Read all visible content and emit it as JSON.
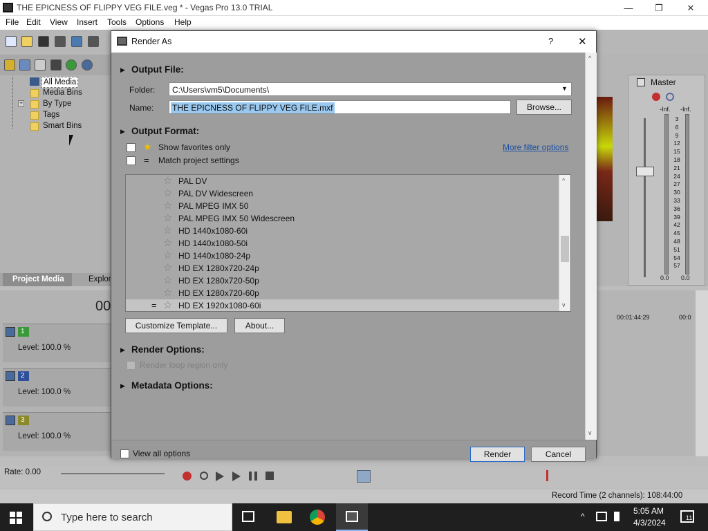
{
  "window": {
    "title": "THE EPICNESS OF FLIPPY VEG FILE.veg * - Vegas Pro 13.0 TRIAL",
    "minimize": "—",
    "maximize": "❐",
    "close": "✕"
  },
  "menu": [
    "File",
    "Edit",
    "View",
    "Insert",
    "Tools",
    "Options",
    "Help"
  ],
  "project_tree": {
    "items": [
      "All Media",
      "Media Bins",
      "By Type",
      "Tags",
      "Smart Bins"
    ],
    "expand": "+"
  },
  "panel_tabs": {
    "project_media": "Project Media",
    "explorer": "Explor"
  },
  "timeline": {
    "time_partial": "00",
    "tracks": [
      {
        "number": "1",
        "level": "Level: 100.0 %",
        "color": "#3a9a3a"
      },
      {
        "number": "2",
        "level": "Level: 100.0 %",
        "color": "#2f4f9a"
      },
      {
        "number": "3",
        "level": "Level: 100.0 %",
        "color": "#8a8a2a"
      }
    ],
    "rate": "Rate: 0.00",
    "ruler_time": "00:01:44:29",
    "ruler_time_partial": "00:0"
  },
  "mixer": {
    "title": "Master",
    "left_inf": "-Inf.",
    "right_inf": "-Inf.",
    "scale": [
      "3",
      "6",
      "9",
      "12",
      "15",
      "18",
      "21",
      "24",
      "27",
      "30",
      "33",
      "36",
      "39",
      "42",
      "45",
      "48",
      "51",
      "54",
      "57"
    ],
    "left_value": "0.0",
    "right_value": "0.0"
  },
  "status": {
    "record_time": "Record Time (2 channels): 108:44:00"
  },
  "dialog": {
    "title": "Render As",
    "help": "?",
    "close": "✕",
    "output_file": {
      "header": "Output File:",
      "folder_label": "Folder:",
      "folder_value": "C:\\Users\\vm5\\Documents\\",
      "name_label": "Name:",
      "name_value": "THE EPICNESS OF FLIPPY VEG FILE.mxf",
      "browse": "Browse..."
    },
    "output_format": {
      "header": "Output Format:",
      "show_favorites": "Show favorites only",
      "match_project": "Match project settings",
      "more_filter": "More filter options",
      "templates": [
        "PAL DV",
        "PAL DV Widescreen",
        "PAL MPEG IMX 50",
        "PAL MPEG IMX 50 Widescreen",
        "HD 1440x1080-60i",
        "HD 1440x1080-50i",
        "HD 1440x1080-24p",
        "HD EX 1280x720-24p",
        "HD EX 1280x720-50p",
        "HD EX 1280x720-60p",
        "HD EX 1920x1080-60i"
      ],
      "selected_marker": "=",
      "customize": "Customize Template...",
      "about": "About..."
    },
    "render_options": {
      "header": "Render Options:",
      "loop_region": "Render loop region only"
    },
    "metadata_options": {
      "header": "Metadata Options:"
    },
    "view_all": "View all options",
    "render": "Render",
    "cancel": "Cancel"
  },
  "taskbar": {
    "search_placeholder": "Type here to search",
    "time": "5:05 AM",
    "date": "4/3/2024",
    "notifications": "11"
  }
}
